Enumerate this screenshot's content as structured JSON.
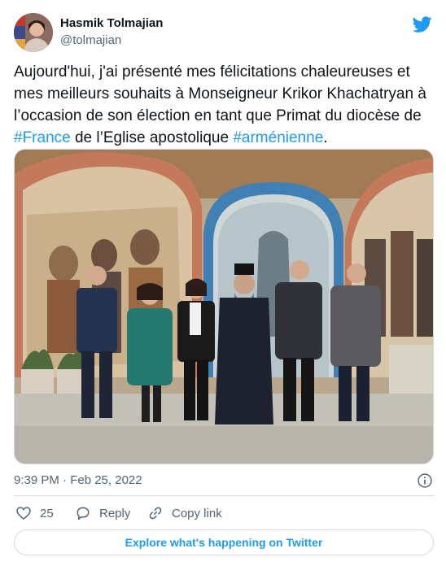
{
  "author": {
    "name": "Hasmik Tolmajian",
    "handle": "@tolmajian"
  },
  "tweet": {
    "text_before_france": "Aujourd'hui, j'ai présenté mes félicitations chaleureuses et mes meilleurs souhaits à Monseigneur Krikor Khachatryan à l’occasion de son élection en tant que Primat du diocèse de ",
    "hashtag_france": "#France",
    "text_middle": " de l’Eglise apostolique ",
    "hashtag_armenienne": "#arménienne",
    "text_end": "."
  },
  "meta": {
    "timestamp": "9:39 PM · Feb 25, 2022"
  },
  "actions": {
    "like_count": "25",
    "reply_label": "Reply",
    "copy_label": "Copy link"
  },
  "explore": {
    "label": "Explore what's happening on Twitter"
  },
  "icons": {
    "bird": "twitter-bird-icon",
    "info": "info-icon",
    "like": "heart-icon",
    "reply": "reply-bubble-icon",
    "copy": "link-icon"
  },
  "colors": {
    "accent": "#1d9bf0",
    "text": "#0f1419",
    "secondary": "#536471",
    "border": "#cfd9de"
  }
}
